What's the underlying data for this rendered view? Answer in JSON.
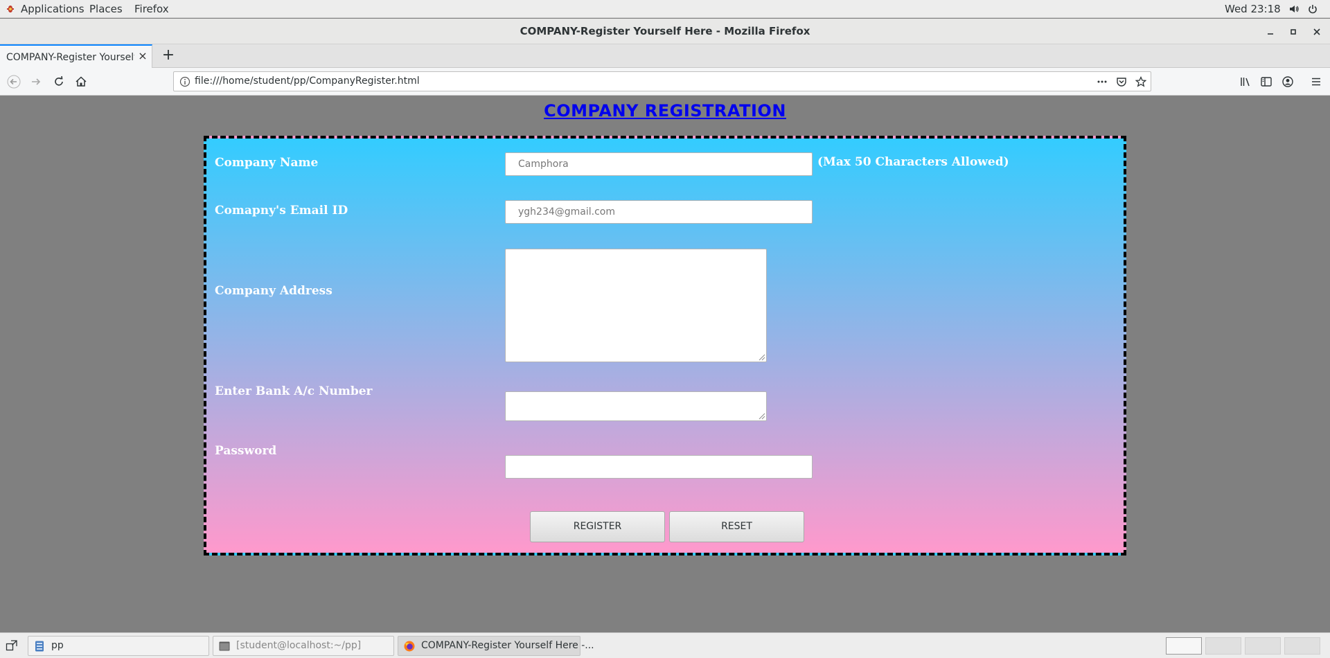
{
  "topbar": {
    "applications": "Applications",
    "places": "Places",
    "firefox": "Firefox",
    "clock": "Wed 23:18"
  },
  "window": {
    "title": "COMPANY-Register Yourself Here - Mozilla Firefox"
  },
  "browser": {
    "tab_title": "COMPANY-Register Yourself Here",
    "url": "file:///home/student/pp/CompanyRegister.html"
  },
  "page": {
    "heading": "COMPANY REGISTRATION",
    "form": {
      "company_name_label": "Company Name",
      "company_name_value": "Camphora",
      "company_name_hint": "(Max 50 Characters Allowed)",
      "email_label": "Comapny's Email ID",
      "email_value": "ygh234@gmail.com",
      "address_label": "Company Address",
      "address_value": "",
      "bank_label": "Enter Bank A/c Number",
      "bank_value": "",
      "password_label": "Password",
      "password_value": "",
      "register_button": "REGISTER",
      "reset_button": "RESET"
    }
  },
  "taskbar": {
    "items": [
      {
        "label": "pp",
        "active": false
      },
      {
        "label": "[student@localhost:~/pp]",
        "active": false
      },
      {
        "label": "COMPANY-Register Yourself Here -...",
        "active": true
      }
    ]
  },
  "colors": {
    "page_background": "#808080",
    "gradient_top": "#33ccff",
    "gradient_bottom": "#ff99cc",
    "heading_link": "#0000ee",
    "tab_accent": "#0a84ff"
  }
}
